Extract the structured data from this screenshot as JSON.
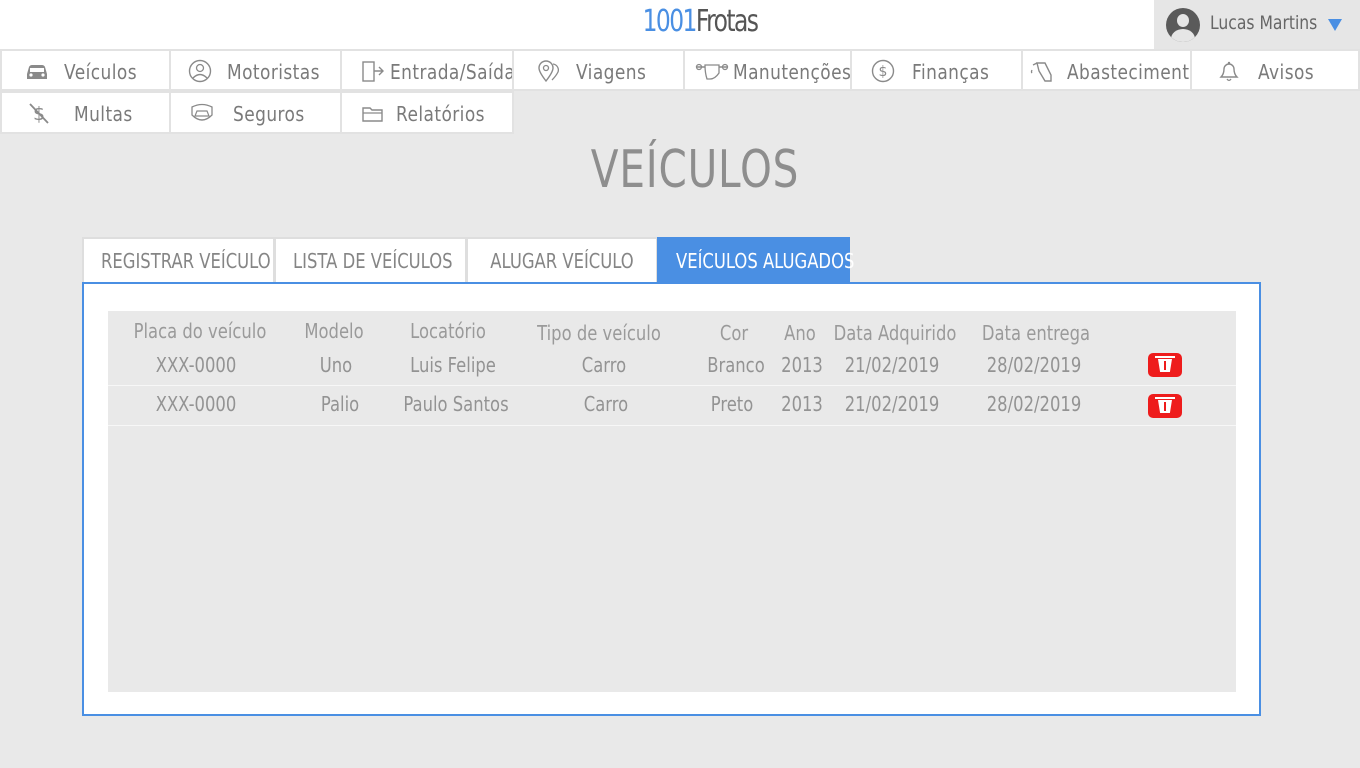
{
  "header": {
    "brand_number": "1001",
    "brand_word": "Frotas",
    "user_name": "Lucas Martins"
  },
  "nav": [
    {
      "label": "Veículos",
      "icon": "car-icon"
    },
    {
      "label": "Motoristas",
      "icon": "driver-icon"
    },
    {
      "label": "Entrada/Saída",
      "icon": "door-exit-icon"
    },
    {
      "label": "Viagens",
      "icon": "map-pins-icon"
    },
    {
      "label": "Manutenções",
      "icon": "wrench-hand-icon"
    },
    {
      "label": "Finanças",
      "icon": "dollar-circle-icon"
    },
    {
      "label": "Abastecimento",
      "icon": "fuel-nozzle-icon"
    },
    {
      "label": "Avisos",
      "icon": "bell-icon"
    },
    {
      "label": "Multas",
      "icon": "dollar-slash-icon"
    },
    {
      "label": "Seguros",
      "icon": "insured-car-icon"
    },
    {
      "label": "Relatórios",
      "icon": "folder-icon"
    }
  ],
  "page_title": "VEÍCULOS",
  "tabs": [
    {
      "label": "REGISTRAR VEÍCULO"
    },
    {
      "label": "LISTA DE VEÍCULOS"
    },
    {
      "label": "ALUGAR VEÍCULO"
    },
    {
      "label": "VEÍCULOS ALUGADOS",
      "active": true
    }
  ],
  "table": {
    "headers": [
      "Placa do veículo",
      "Modelo",
      "Locatório",
      "Tipo de veículo",
      "Cor",
      "Ano",
      "Data Adquirido",
      "Data entrega"
    ],
    "rows": [
      [
        "XXX-0000",
        "Uno",
        "Luis Felipe",
        "Carro",
        "Branco",
        "2013",
        "21/02/2019",
        "28/02/2019"
      ],
      [
        "XXX-0000",
        "Palio",
        "Paulo Santos",
        "Carro",
        "Preto",
        "2013",
        "21/02/2019",
        "28/02/2019"
      ]
    ]
  },
  "colors": {
    "accent": "#4a8fe3",
    "delete": "#ee1c1c"
  }
}
